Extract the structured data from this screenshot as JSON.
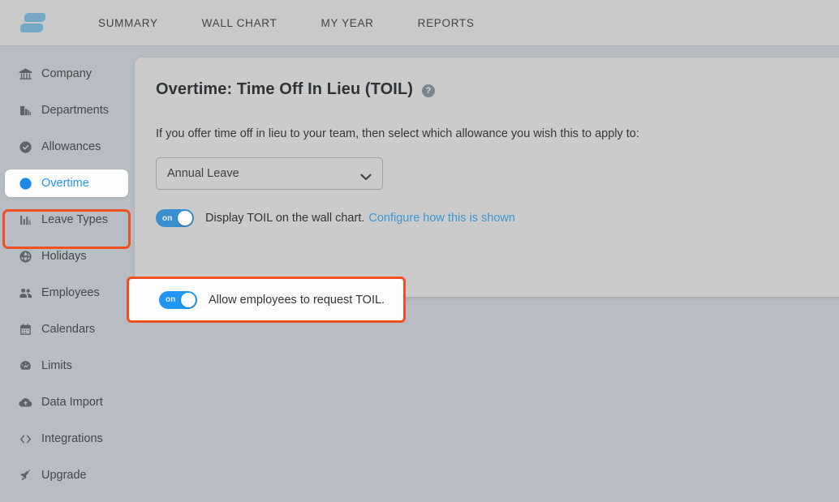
{
  "topbar": {
    "logo_name": "app-logo",
    "nav": [
      {
        "label": "SUMMARY"
      },
      {
        "label": "WALL CHART"
      },
      {
        "label": "MY YEAR"
      },
      {
        "label": "REPORTS"
      }
    ]
  },
  "sidebar": {
    "items": [
      {
        "label": "Company",
        "icon": "bank-icon",
        "active": false
      },
      {
        "label": "Departments",
        "icon": "building-icon",
        "active": false
      },
      {
        "label": "Allowances",
        "icon": "check-circle-icon",
        "active": false
      },
      {
        "label": "Overtime",
        "icon": "clock-icon",
        "active": true
      },
      {
        "label": "Leave Types",
        "icon": "bar-chart-icon",
        "active": false
      },
      {
        "label": "Holidays",
        "icon": "globe-icon",
        "active": false
      },
      {
        "label": "Employees",
        "icon": "people-icon",
        "active": false
      },
      {
        "label": "Calendars",
        "icon": "calendar-icon",
        "active": false
      },
      {
        "label": "Limits",
        "icon": "gauge-icon",
        "active": false
      },
      {
        "label": "Data Import",
        "icon": "cloud-upload-icon",
        "active": false
      },
      {
        "label": "Integrations",
        "icon": "code-brackets-icon",
        "active": false
      },
      {
        "label": "Upgrade",
        "icon": "rocket-icon",
        "active": false
      }
    ]
  },
  "main": {
    "title": "Overtime: Time Off In Lieu (TOIL)",
    "help_glyph": "?",
    "description": "If you offer time off in lieu to your team, then select which allowance you wish this to apply to:",
    "allowance_select": {
      "value": "Annual Leave",
      "options": [
        "Annual Leave"
      ]
    },
    "toggles": [
      {
        "state_label": "on",
        "label": "Display TOIL on the wall chart.",
        "link_label": "Configure how this is shown"
      },
      {
        "state_label": "on",
        "label": "Allow employees to request TOIL."
      }
    ]
  },
  "annotations": {
    "accent_color": "#f04e23",
    "sidebar_target": "Overtime",
    "toggle_target": "Allow employees to request TOIL."
  },
  "colors": {
    "accent_blue": "#2196f3",
    "link_blue": "#3d96cf",
    "logo_blue": "#74a8c4",
    "annotation": "#f04e23",
    "page_bg": "#b7bdc2",
    "card_bg": "#cbcbcb",
    "topbar_bg": "#c9c9c9"
  }
}
